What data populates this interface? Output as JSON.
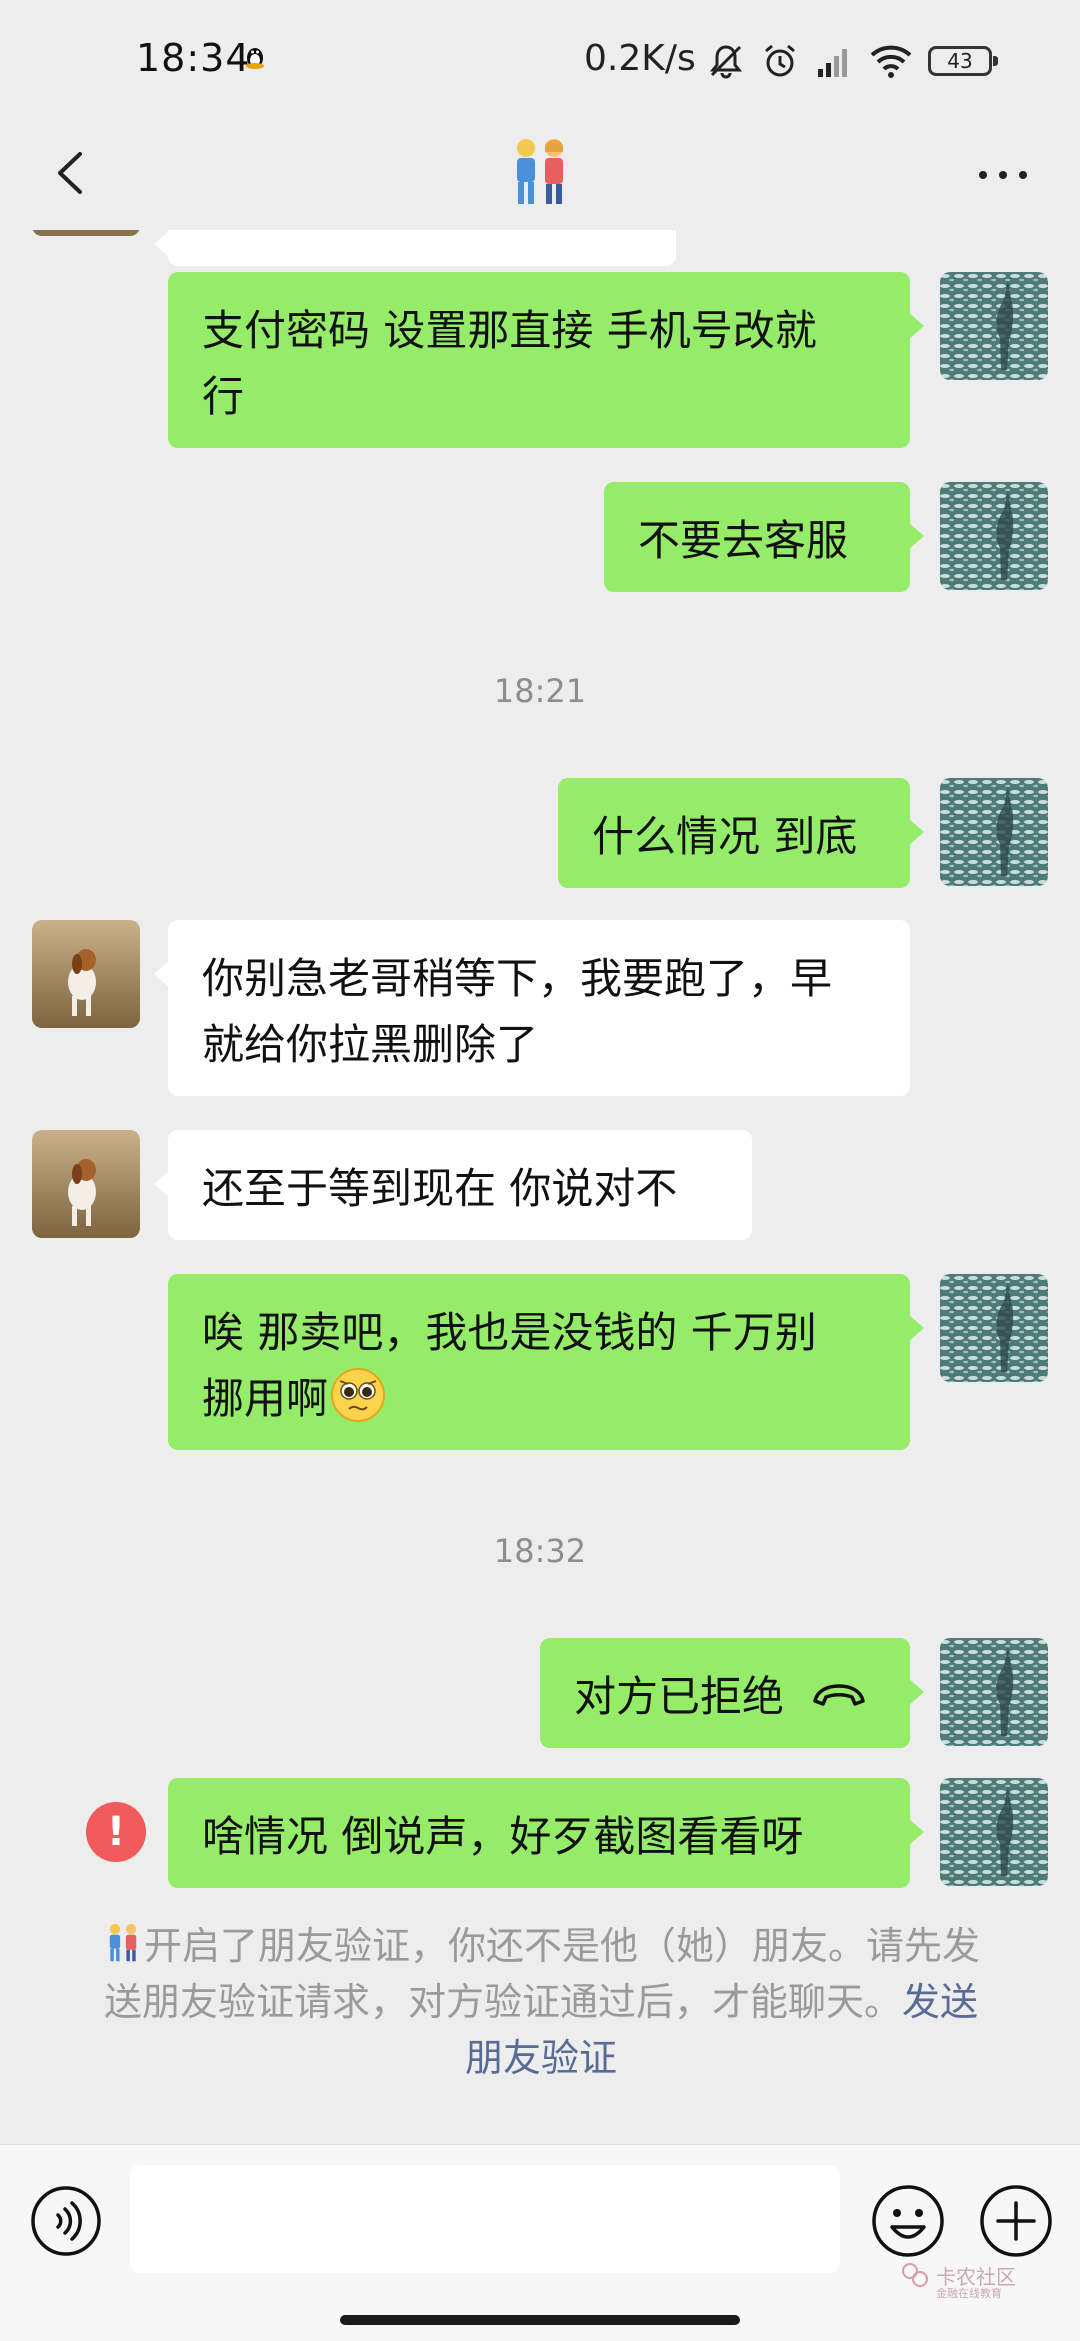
{
  "status_bar": {
    "time": "18:34",
    "net_speed": "0.2K/s",
    "battery_level": "43",
    "icons": [
      "qq-penguin-icon",
      "mute-icon",
      "alarm-icon",
      "signal-icon",
      "wifi-icon",
      "battery-icon"
    ]
  },
  "title_bar": {
    "title_emoji": "couple-emoji-icon",
    "back_icon": "chevron-left-icon",
    "more_icon": "ellipsis-icon"
  },
  "messages": [
    {
      "side": "me",
      "text": "支付密码 设置那直接 手机号改就\n行"
    },
    {
      "side": "me",
      "text": "不要去客服"
    },
    {
      "type": "time",
      "text": "18:21"
    },
    {
      "side": "me",
      "text": "什么情况 到底"
    },
    {
      "side": "them",
      "text": "你别急老哥稍等下，我要跑了，早\n就给你拉黑删除了"
    },
    {
      "side": "them",
      "text": "还至于等到现在 你说对不"
    },
    {
      "side": "me",
      "text": "唉 那卖吧，我也是没钱的 千万别\n挪用啊",
      "emoji": "pleading-face-icon"
    },
    {
      "type": "time",
      "text": "18:32"
    },
    {
      "side": "me",
      "text": "对方已拒绝",
      "icon": "hangup-icon"
    },
    {
      "side": "me",
      "text": "啥情况 倒说声，好歹截图看看呀",
      "failed": true,
      "error_mark": "!"
    }
  ],
  "notice": {
    "text": "开启了朋友验证，你还不是他（她）朋友。请先发送朋友验证请求，对方验证通过后，才能聊天。",
    "link": "发送朋友验证"
  },
  "input_bar": {
    "voice_icon": "voice-icon",
    "emoji_icon": "smiley-icon",
    "plus_icon": "plus-circle-icon"
  },
  "watermark": {
    "text": "卡农社区",
    "sub": "金融在线教育"
  },
  "colors": {
    "background": "#ededed",
    "my_bubble": "#95ec69",
    "their_bubble": "#ffffff",
    "link": "#576b95",
    "error": "#f05a5a"
  }
}
